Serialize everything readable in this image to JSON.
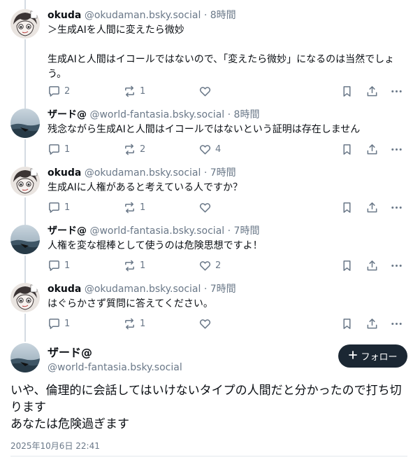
{
  "posts": [
    {
      "name": "okuda",
      "handle": "@okudaman.bsky.social",
      "time": "8時間",
      "text": "＞生成AIを人間に変えたら微妙\n\n生成AIと人間はイコールではないので、「変えたら微妙」になるのは当然でしょう。",
      "reply_count": "2",
      "repost_count": "1",
      "like_count": ""
    },
    {
      "name": "ザード@",
      "handle": "@world-fantasia.bsky.social",
      "time": "8時間",
      "text": "残念ながら生成AIと人間はイコールではないという証明は存在しません",
      "reply_count": "1",
      "repost_count": "2",
      "like_count": "4"
    },
    {
      "name": "okuda",
      "handle": "@okudaman.bsky.social",
      "time": "7時間",
      "text": "生成AIに人権があると考えている人ですか？",
      "reply_count": "1",
      "repost_count": "1",
      "like_count": ""
    },
    {
      "name": "ザード@",
      "handle": "@world-fantasia.bsky.social",
      "time": "7時間",
      "text": "人権を変な棍棒として使うのは危険思想ですよ！",
      "reply_count": "1",
      "repost_count": "1",
      "like_count": "2"
    },
    {
      "name": "okuda",
      "handle": "@okudaman.bsky.social",
      "time": "7時間",
      "text": "はぐらかさず質問に答えてください。",
      "reply_count": "1",
      "repost_count": "1",
      "like_count": ""
    }
  ],
  "main_post": {
    "name": "ザード@",
    "handle": "@world-fantasia.bsky.social",
    "follow_label": "フォロー",
    "text": "いや、倫理的に会話してはいけないタイプの人間だと分かったので打ち切ります\nあなたは危険過ぎます",
    "date": "2025年10月6日 22:41"
  },
  "separator": "·",
  "icons": [
    "reply-icon",
    "repost-icon",
    "like-icon",
    "bookmark-icon",
    "share-icon",
    "more-icon",
    "plus-icon"
  ],
  "colors": {
    "muted": "#6a7888",
    "follow_bg": "#1b2733",
    "thread_line": "#d4dbe2"
  }
}
